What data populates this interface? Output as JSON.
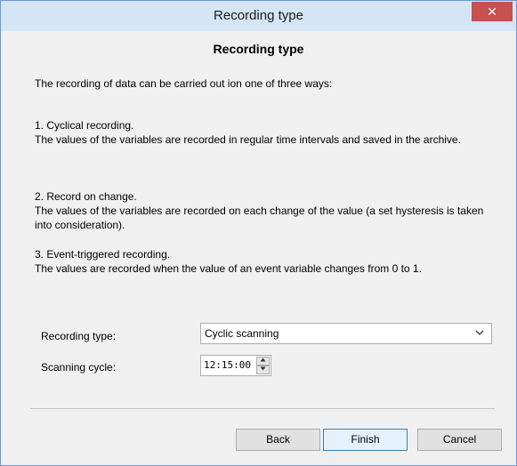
{
  "window": {
    "title": "Recording type",
    "close_glyph": "✕"
  },
  "content": {
    "heading": "Recording type",
    "intro": "The recording of data can be carried out ion one of three ways:",
    "items": [
      {
        "title": "1. Cyclical recording.",
        "description": "The values of the variables are recorded in regular time intervals and saved in the archive."
      },
      {
        "title": "2. Record on change.",
        "description": "The values of the variables are recorded on each change of the value (a set hysteresis is taken into consideration)."
      },
      {
        "title": "3. Event-triggered recording.",
        "description": "The values are recorded when the value of an event variable changes from 0 to 1."
      }
    ]
  },
  "form": {
    "recording_type_label": "Recording type:",
    "recording_type_value": "Cyclic scanning",
    "scanning_cycle_label": "Scanning cycle:",
    "scanning_cycle_value": "12:15:00"
  },
  "buttons": {
    "back": "Back",
    "finish": "Finish",
    "cancel": "Cancel"
  },
  "icons": {
    "dropdown": "chevron-down-icon",
    "spin_up": "arrow-up-icon",
    "spin_down": "arrow-down-icon",
    "close": "close-icon"
  },
  "colors": {
    "titlebar": "#d6e5f5",
    "close_button": "#c75050",
    "window_bg": "#f0f0f0"
  }
}
